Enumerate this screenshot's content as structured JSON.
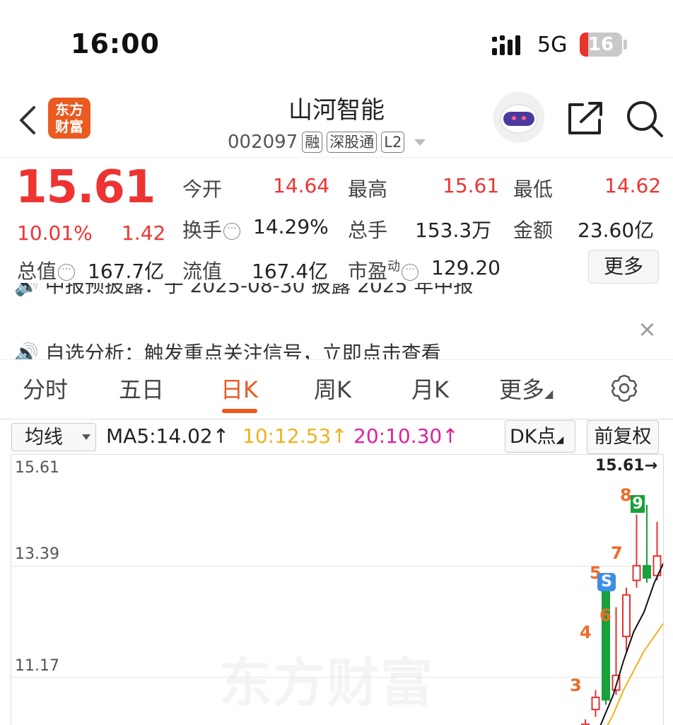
{
  "status_bar": {
    "time": "16:00",
    "network": "5G",
    "battery": "16"
  },
  "header": {
    "logo_line1": "东方",
    "logo_line2": "财富",
    "stock_name": "山河智能",
    "stock_code": "002097",
    "tags": [
      "融",
      "深股通",
      "L2"
    ]
  },
  "quote": {
    "price": "15.61",
    "change_pct": "10.01%",
    "change_amt": "1.42",
    "stats": [
      {
        "label": "今开",
        "value": "14.64"
      },
      {
        "label": "最高",
        "value": "15.61"
      },
      {
        "label": "最低",
        "value": "14.62"
      },
      {
        "label": "换手",
        "value": "14.29%"
      },
      {
        "label": "总手",
        "value": "153.3万"
      },
      {
        "label": "金额",
        "value": "23.60亿"
      },
      {
        "label": "总值",
        "value": "167.7亿"
      },
      {
        "label": "流值",
        "value": "167.4亿"
      },
      {
        "label": "市盈",
        "sup": "动",
        "value": "129.20"
      }
    ],
    "more_label": "更多"
  },
  "news": {
    "item1": "中报预披露：于 2025-08-30 披露 2025 年中报",
    "item2": "自选分析：触发重点关注信号，立即点击查看",
    "close": "×"
  },
  "tabs": [
    "分时",
    "五日",
    "日K",
    "周K",
    "月K",
    "更多"
  ],
  "active_tab": "日K",
  "ma_bar": {
    "select_label": "均线",
    "ma5": "MA5:14.02↑",
    "ma10": "10:12.53↑",
    "ma20": "20:10.30↑",
    "dk_label": "DK点",
    "fq_label": "前复权"
  },
  "colors": {
    "up": "#e33333",
    "down": "#18a03a",
    "accent": "#ea5a21",
    "ma10": "#f2b01e",
    "ma20": "#e020a0"
  },
  "chart_data": {
    "type": "candlestick",
    "y_ticks": [
      "15.61",
      "13.39",
      "11.17"
    ],
    "ylim": [
      9.5,
      15.61
    ],
    "high_label": "15.61→",
    "watermark": "东方财富",
    "signal_markers": [
      "3",
      "4",
      "5",
      "S",
      "6",
      "7",
      "8",
      "9"
    ],
    "candles": [
      {
        "open": 10.05,
        "close": 10.2,
        "high": 10.3,
        "low": 9.95
      },
      {
        "open": 10.5,
        "close": 10.75,
        "high": 10.9,
        "low": 10.35
      },
      {
        "open": 12.95,
        "close": 10.7,
        "high": 13.0,
        "low": 10.6
      },
      {
        "open": 10.9,
        "close": 11.2,
        "high": 12.6,
        "low": 10.8
      },
      {
        "open": 12.0,
        "close": 12.85,
        "high": 13.0,
        "low": 11.7
      },
      {
        "open": 13.15,
        "close": 13.45,
        "high": 14.5,
        "low": 13.0
      },
      {
        "open": 13.45,
        "close": 13.2,
        "high": 14.7,
        "low": 13.1
      },
      {
        "open": 13.25,
        "close": 13.65,
        "high": 14.35,
        "low": 13.15
      },
      {
        "open": 13.65,
        "close": 14.1,
        "high": 14.3,
        "low": 13.35
      },
      {
        "open": 14.64,
        "close": 15.61,
        "high": 15.61,
        "low": 14.62
      }
    ],
    "ma5_points": [
      9.5,
      9.8,
      10.3,
      10.8,
      11.5,
      12.1,
      12.5,
      13.1,
      13.55,
      14.02
    ],
    "ma10_points": [
      9.5,
      9.7,
      10.0,
      10.4,
      10.9,
      11.3,
      11.7,
      12.0,
      12.3,
      12.53
    ]
  }
}
